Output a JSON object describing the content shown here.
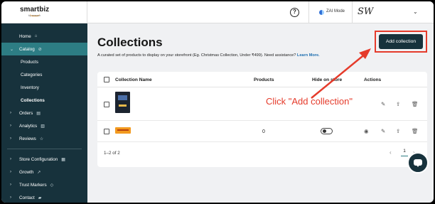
{
  "brand": {
    "name": "smartbiz",
    "sub": "by amazon"
  },
  "sidebar": {
    "items": [
      {
        "label": "Home",
        "icon": "home-icon",
        "glyph": "⌂"
      },
      {
        "label": "Catalog",
        "icon": "tag-icon",
        "glyph": "⊘"
      },
      {
        "label": "Products"
      },
      {
        "label": "Categories"
      },
      {
        "label": "Inventory"
      },
      {
        "label": "Collections"
      },
      {
        "label": "Orders",
        "icon": "receipt-icon",
        "glyph": "▤"
      },
      {
        "label": "Analytics",
        "icon": "bar-chart-icon",
        "glyph": "▥"
      },
      {
        "label": "Reviews",
        "icon": "star-icon",
        "glyph": "☆"
      },
      {
        "label": "Store Configuration",
        "icon": "store-icon",
        "glyph": "▦"
      },
      {
        "label": "Growth",
        "icon": "trend-icon",
        "glyph": "↗"
      },
      {
        "label": "Trust Markers",
        "icon": "shield-icon",
        "glyph": "◇"
      },
      {
        "label": "Contact",
        "icon": "chat-icon",
        "glyph": "▰"
      }
    ]
  },
  "topbar": {
    "help_glyph": "?",
    "mode_label": "ZAI Mode",
    "signature": "SW",
    "account_chevron": "⌄"
  },
  "page": {
    "title": "Collections",
    "description": "A curated set of products to display on your storefront (Eg. Christmas Collection, Under ₹499). Need assistance?",
    "learn_more": "Learn More.",
    "add_button": "Add collection"
  },
  "table": {
    "headers": {
      "name": "Collection Name",
      "products": "Products",
      "hide": "Hide on store",
      "actions": "Actions"
    },
    "rows": [
      {
        "products": "",
        "hidden": false
      },
      {
        "products": "0",
        "hidden": false
      }
    ]
  },
  "pagination": {
    "range": "1–2 of 2",
    "current_page": "1",
    "prev": "‹",
    "next": "›"
  },
  "annotation": {
    "text": "Click \"Add collection\"",
    "color": "#e53b2b"
  },
  "colors": {
    "sidebar_bg": "#17323c",
    "active": "#2d7d84",
    "primary_btn": "#17323c",
    "highlight": "#e53b2b"
  }
}
